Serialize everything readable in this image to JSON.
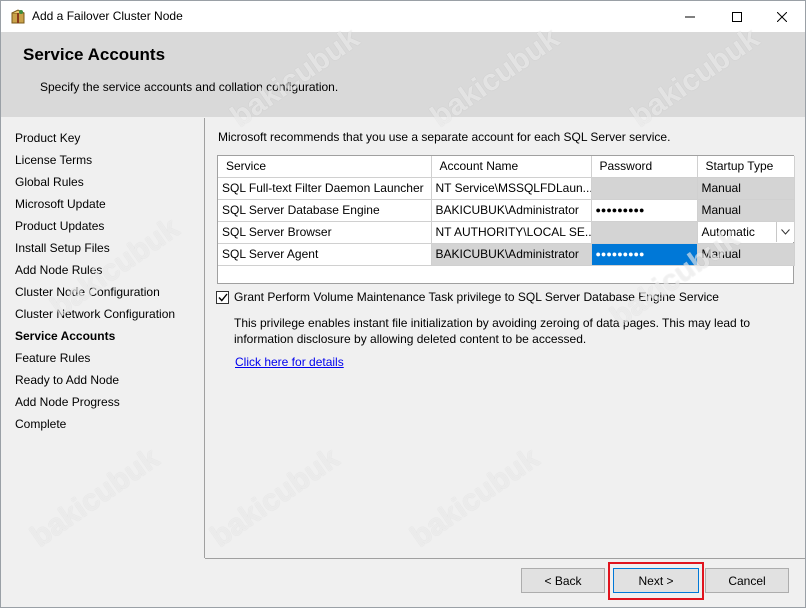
{
  "window": {
    "title": "Add a Failover Cluster Node"
  },
  "header": {
    "title": "Service Accounts",
    "subtitle": "Specify the service accounts and collation configuration."
  },
  "nav": {
    "items": [
      {
        "label": "Product Key"
      },
      {
        "label": "License Terms"
      },
      {
        "label": "Global Rules"
      },
      {
        "label": "Microsoft Update"
      },
      {
        "label": "Product Updates"
      },
      {
        "label": "Install Setup Files"
      },
      {
        "label": "Add Node Rules"
      },
      {
        "label": "Cluster Node Configuration"
      },
      {
        "label": "Cluster Network Configuration"
      },
      {
        "label": "Service Accounts",
        "active": true
      },
      {
        "label": "Feature Rules"
      },
      {
        "label": "Ready to Add Node"
      },
      {
        "label": "Add Node Progress"
      },
      {
        "label": "Complete"
      }
    ]
  },
  "content": {
    "recommendation": "Microsoft recommends that you use a separate account for each SQL Server service.",
    "grid": {
      "columns": [
        "Service",
        "Account Name",
        "Password",
        "Startup Type"
      ],
      "rows": [
        {
          "service": "SQL Full-text Filter Daemon Launcher",
          "account": "NT Service\\MSSQLFDLaun...",
          "password": "",
          "startup": "Manual"
        },
        {
          "service": "SQL Server Database Engine",
          "account": "BAKICUBUK\\Administrator",
          "password": "●●●●●●●●●",
          "startup": "Manual"
        },
        {
          "service": "SQL Server Browser",
          "account": "NT AUTHORITY\\LOCAL SE...",
          "password": "",
          "startup": "Automatic"
        },
        {
          "service": "SQL Server Agent",
          "account": "BAKICUBUK\\Administrator",
          "password": "●●●●●●●●●",
          "startup": "Manual"
        }
      ]
    },
    "grant_checkbox": {
      "label": "Grant Perform Volume Maintenance Task privilege to SQL Server Database Engine Service",
      "checked": true
    },
    "privilege_text": "This privilege enables instant file initialization by avoiding zeroing of data pages. This may lead to information disclosure by allowing deleted content to be accessed.",
    "details_link": "Click here for details"
  },
  "footer": {
    "back_label": "< Back",
    "next_label": "Next >",
    "cancel_label": "Cancel"
  },
  "watermark": "bakicubuk",
  "colors": {
    "selection": "#0078d7",
    "highlight_box": "#e0141e",
    "link": "#0000ee"
  }
}
